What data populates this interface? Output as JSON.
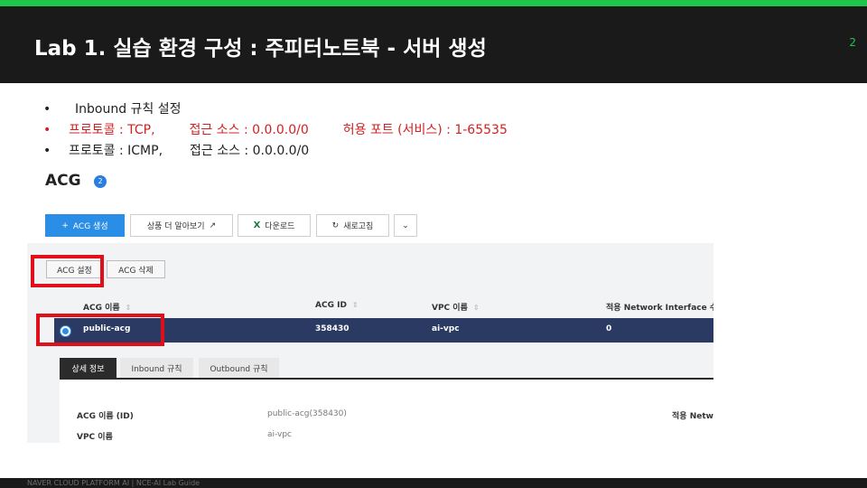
{
  "slide": {
    "title": "Lab 1. 실습 환경 구성 : 주피터노트북 - 서버 생성",
    "page_number": "2",
    "colors": {
      "accent_green": "#1ec74b",
      "header_bg": "#1a1a1a",
      "highlight_red": "#e0101a",
      "bullet_red": "#d42020"
    }
  },
  "bullets": [
    {
      "dot": "•",
      "text": "Inbound 규칙 설정"
    },
    {
      "dot": "•",
      "protocol": "프로토콜 : TCP,",
      "source": "접근 소스 : 0.0.0.0/0",
      "port": "허용 포트 (서비스) : 1-65535"
    },
    {
      "dot": "•",
      "protocol": "프로토콜 : ICMP,",
      "source": "접근 소스 : 0.0.0.0/0"
    }
  ],
  "console": {
    "title": "ACG",
    "badge": "2",
    "toolbar": {
      "create": {
        "icon": "plus-icon",
        "glyph": "+",
        "label": "ACG 생성"
      },
      "more_info": {
        "label": "상품 더 알아보기",
        "icon": "external-link-icon",
        "glyph": "↗"
      },
      "download": {
        "icon": "excel-icon",
        "glyph": "X",
        "label": "다운로드"
      },
      "refresh": {
        "icon": "refresh-icon",
        "glyph": "↻",
        "label": "새로고침"
      },
      "dropdown": {
        "icon": "chevron-down-icon",
        "glyph": "⌄"
      }
    },
    "actions": {
      "settings": "ACG 설정",
      "delete": "ACG 삭제"
    },
    "table": {
      "sort_glyph": "⇕",
      "headers": [
        "ACG 이름",
        "ACG ID",
        "VPC 이름",
        "적용 Network Interface 수"
      ],
      "rows": [
        {
          "selected": true,
          "name": "public-acg",
          "id": "358430",
          "vpc": "ai-vpc",
          "nic_count": "0"
        }
      ]
    },
    "detail_tabs": [
      "상세 정보",
      "Inbound 규칙",
      "Outbound 규칙"
    ],
    "detail": {
      "name_label": "ACG 이름 (ID)",
      "name_value": "public-acg(358430)",
      "vpc_label": "VPC 이름",
      "vpc_value": "ai-vpc",
      "nic_label": "적용 Netwo"
    }
  },
  "footer": {
    "text": "NAVER CLOUD PLATFORM AI  |  NCE-AI Lab Guide"
  }
}
